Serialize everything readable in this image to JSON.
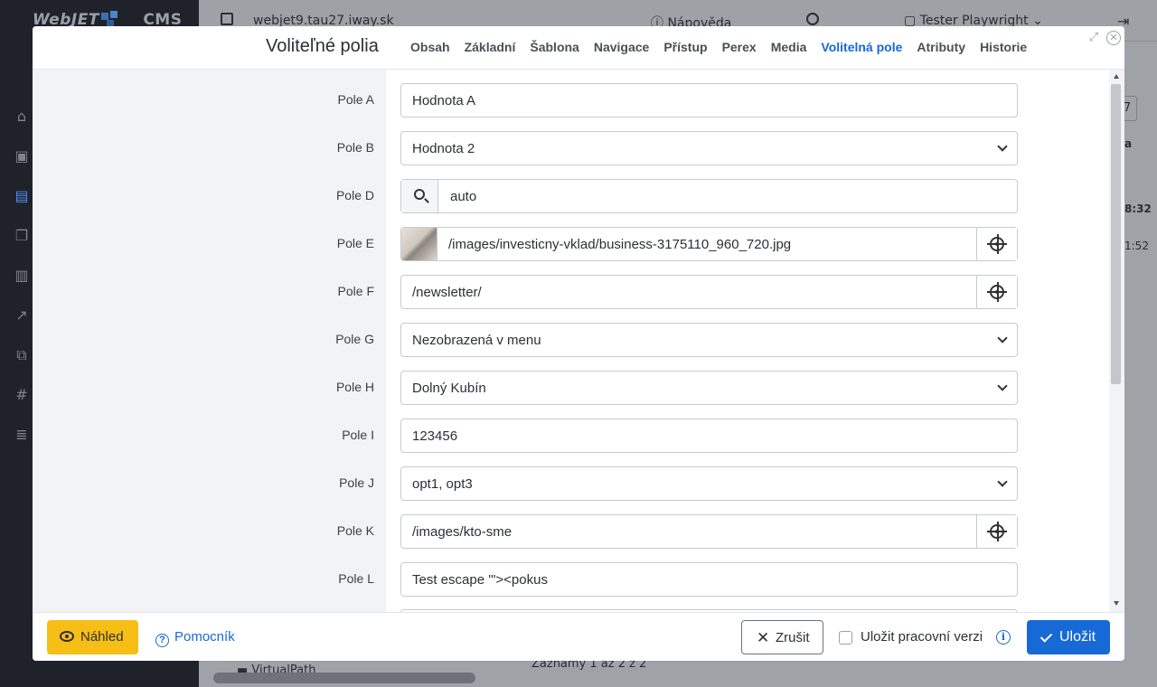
{
  "app": {
    "logo": "WebJET",
    "logo_cms": "CMS",
    "url": "webjet9.tau27.iway.sk",
    "help": "Nápověda",
    "user": "Tester Playwright",
    "right_value_1": "7",
    "right_text_a": "a",
    "right_time_1": "8:32",
    "right_time_2": "1:52",
    "records": "Záznamy 1 až 2 z 2",
    "tree_item": "VirtualPath",
    "page_num": "1"
  },
  "modal": {
    "title": "Voliteľné polia",
    "tabs": [
      "Obsah",
      "Základní",
      "Šablona",
      "Navigace",
      "Přístup",
      "Perex",
      "Media",
      "Volitelná pole",
      "Atributy",
      "Historie"
    ],
    "active_tab": "Volitelná pole",
    "fields": [
      {
        "label": "Pole A",
        "value": "Hodnota A"
      },
      {
        "label": "Pole B",
        "value": "Hodnota 2"
      },
      {
        "label": "Pole D",
        "value": "auto"
      },
      {
        "label": "Pole E",
        "value": "/images/investicny-vklad/business-3175110_960_720.jpg"
      },
      {
        "label": "Pole F",
        "value": "/newsletter/"
      },
      {
        "label": "Pole G",
        "value": "Nezobrazená v menu"
      },
      {
        "label": "Pole H",
        "value": "Dolný Kubín"
      },
      {
        "label": "Pole I",
        "value": "123456"
      },
      {
        "label": "Pole J",
        "value": "opt1, opt3"
      },
      {
        "label": "Pole K",
        "value": "/images/kto-sme"
      },
      {
        "label": "Pole L",
        "value": "Test escape '\"><pokus"
      }
    ]
  },
  "footer": {
    "preview": "Náhled",
    "helper": "Pomocník",
    "cancel": "Zrušit",
    "save_draft": "Uložit pracovní verzi",
    "save": "Uložit"
  },
  "colors": {
    "accent": "#1769d6",
    "preview_button": "#f7be16"
  }
}
